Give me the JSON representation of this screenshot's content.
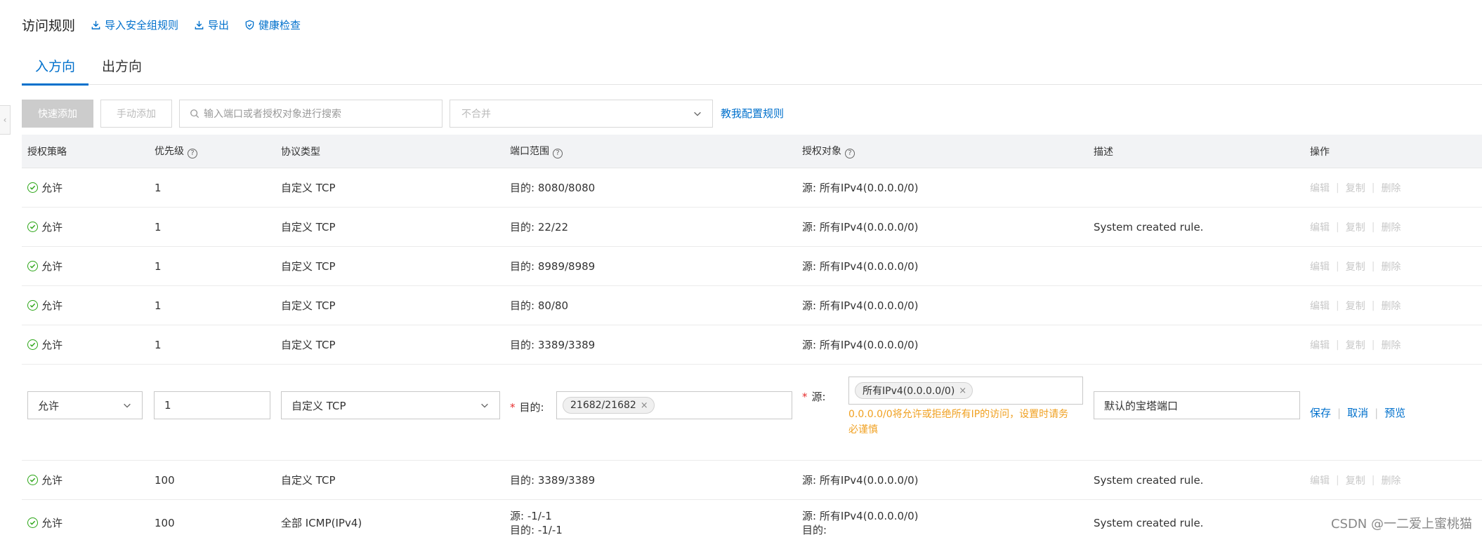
{
  "header": {
    "title": "访问规则",
    "links": [
      {
        "label": "导入安全组规则",
        "icon": "import-icon"
      },
      {
        "label": "导出",
        "icon": "export-icon"
      },
      {
        "label": "健康检查",
        "icon": "shield-icon"
      }
    ]
  },
  "tabs": [
    {
      "label": "入方向",
      "active": true
    },
    {
      "label": "出方向",
      "active": false
    }
  ],
  "toolbar": {
    "quick_add": "快速添加",
    "manual_add": "手动添加",
    "search_placeholder": "输入端口或者授权对象进行搜索",
    "merge_select": "不合并",
    "help_link": "教我配置规则"
  },
  "table": {
    "headers": [
      "授权策略",
      "优先级",
      "协议类型",
      "端口范围",
      "授权对象",
      "描述",
      "操作"
    ],
    "rows": [
      {
        "policy": "允许",
        "priority": "1",
        "protocol": "自定义 TCP",
        "port": "目的: 8080/8080",
        "object": "源: 所有IPv4(0.0.0.0/0)",
        "desc": ""
      },
      {
        "policy": "允许",
        "priority": "1",
        "protocol": "自定义 TCP",
        "port": "目的: 22/22",
        "object": "源: 所有IPv4(0.0.0.0/0)",
        "desc": "System created rule."
      },
      {
        "policy": "允许",
        "priority": "1",
        "protocol": "自定义 TCP",
        "port": "目的: 8989/8989",
        "object": "源: 所有IPv4(0.0.0.0/0)",
        "desc": ""
      },
      {
        "policy": "允许",
        "priority": "1",
        "protocol": "自定义 TCP",
        "port": "目的: 80/80",
        "object": "源: 所有IPv4(0.0.0.0/0)",
        "desc": ""
      },
      {
        "policy": "允许",
        "priority": "1",
        "protocol": "自定义 TCP",
        "port": "目的: 3389/3389",
        "object": "源: 所有IPv4(0.0.0.0/0)",
        "desc": ""
      }
    ],
    "ops": {
      "edit": "编辑",
      "copy": "复制",
      "delete": "删除",
      "sep": "|"
    },
    "edit_row": {
      "policy": "允许",
      "priority": "1",
      "protocol": "自定义 TCP",
      "port_label": "目的:",
      "port_tag": "21682/21682",
      "object_label": "源:",
      "object_tag": "所有IPv4(0.0.0.0/0)",
      "warning": "0.0.0.0/0将允许或拒绝所有IP的访问，设置时请务必谨慎",
      "desc": "默认的宝塔端口",
      "save": "保存",
      "cancel": "取消",
      "preview": "预览",
      "required_mark": "*",
      "tag_close": "×"
    },
    "rows_after": [
      {
        "policy": "允许",
        "priority": "100",
        "protocol": "自定义 TCP",
        "port": "目的: 3389/3389",
        "object": "源: 所有IPv4(0.0.0.0/0)",
        "desc": "System created rule."
      }
    ],
    "last_row": {
      "policy": "允许",
      "priority": "100",
      "protocol": "全部 ICMP(IPv4)",
      "port_line1": "源: -1/-1",
      "port_line2": "目的: -1/-1",
      "object_line1": "源: 所有IPv4(0.0.0.0/0)",
      "object_line2": "目的:",
      "desc": "System created rule."
    }
  },
  "watermark": "CSDN @一二爱上蜜桃猫",
  "colors": {
    "link": "#0070cc",
    "allow": "#2aa515",
    "warning": "#f0a020",
    "required": "#e62e2e"
  }
}
